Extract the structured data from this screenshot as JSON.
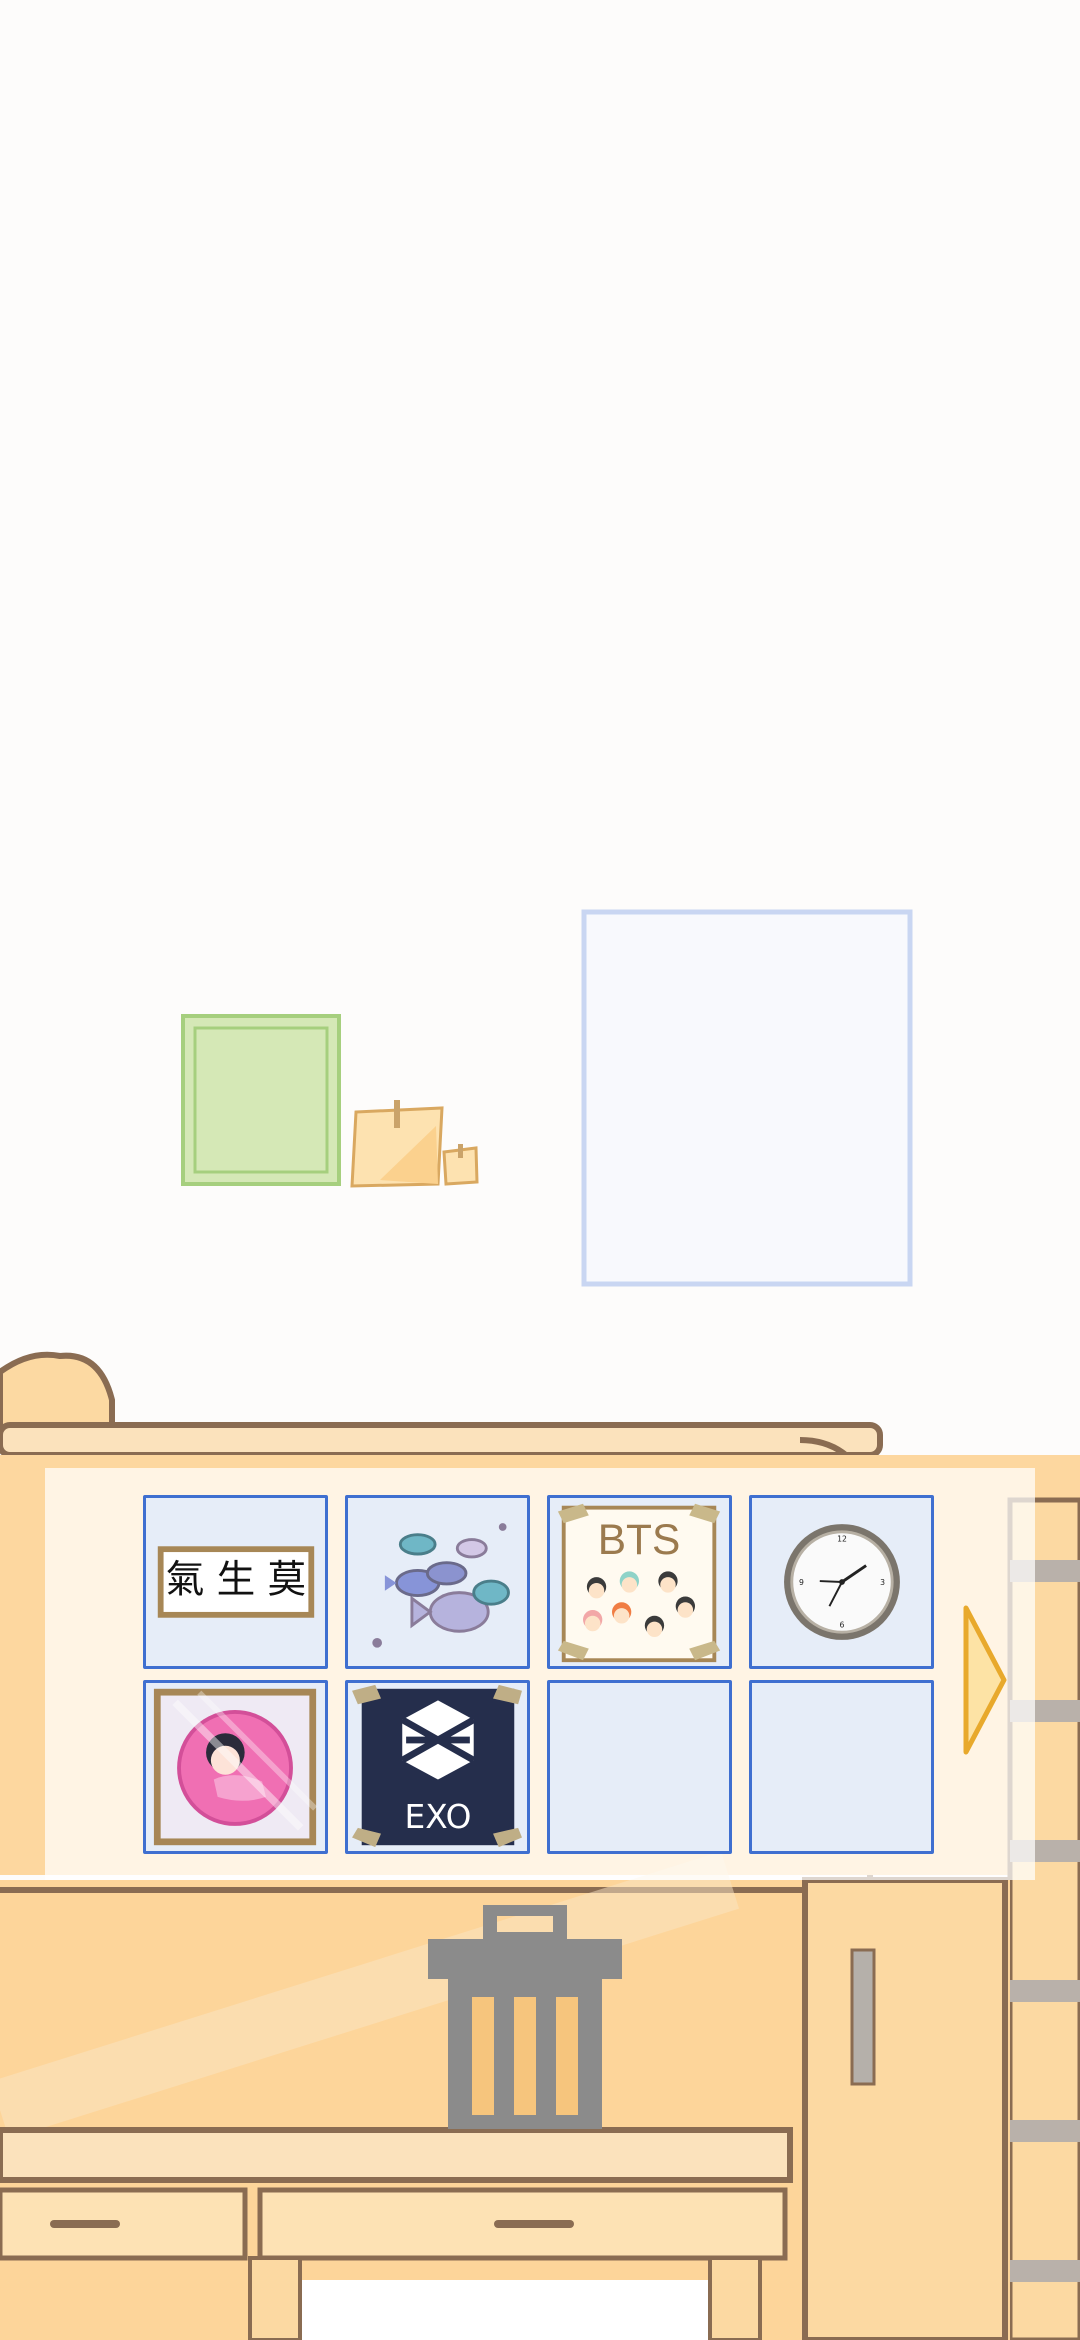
{
  "room": {
    "wall_color": "#fdfcfb",
    "furniture_color": "#fcd9a2"
  },
  "inventory": {
    "items": [
      {
        "name": "calligraphy-frame",
        "text": "氣 生 莫"
      },
      {
        "name": "fish-sticker",
        "text": ""
      },
      {
        "name": "bts-poster",
        "text": "BTS"
      },
      {
        "name": "wall-clock",
        "text": ""
      },
      {
        "name": "anime-girl-frame",
        "text": ""
      },
      {
        "name": "exo-poster",
        "text": "EXO"
      },
      {
        "name": "empty-slot",
        "text": ""
      },
      {
        "name": "empty-slot",
        "text": ""
      }
    ],
    "next_icon": "triangle-right-icon",
    "slot_color": "#e6edf8",
    "slot_border": "#3f6fd0"
  },
  "trash_icon": "trash-can-icon"
}
